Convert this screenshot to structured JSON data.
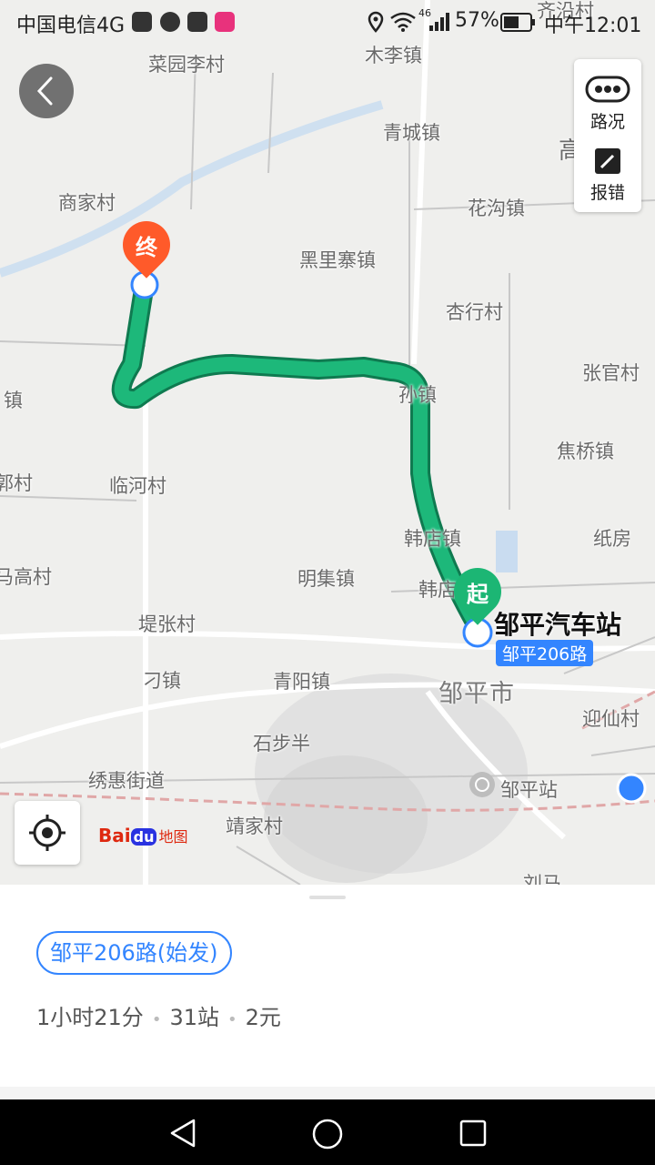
{
  "status_bar": {
    "carrier": "中国电信4G",
    "network_badge": "46",
    "battery": "57%",
    "time": "中午12:01",
    "icons": [
      "baidu-app-icon",
      "qq-icon",
      "tiktok-icon",
      "youku-icon",
      "location-icon",
      "wifi-icon",
      "signal-icon",
      "battery-icon"
    ]
  },
  "map": {
    "places": {
      "caiyuanli": "菜园李村",
      "mulizhen": "木李镇",
      "qichengzhen": "青城镇",
      "huagouzhen": "花沟镇",
      "shangjiacun": "商家村",
      "heilizhaizhen": "黑里寨镇",
      "xinghangcun": "杏行村",
      "zhangguancun": "张官村",
      "sunzhen": "孙镇",
      "zhen_left": "镇",
      "jiaoqiaozhen": "焦桥镇",
      "cun_left": "郭村",
      "linhecun": "临河村",
      "zhifang": "纸房",
      "handianzhen": "韩店镇",
      "magaocun": "马高村",
      "mingjizhen": "明集镇",
      "handian2": "韩店",
      "dizhangcun": "堤张村",
      "diaozhen": "刁镇",
      "qingyangzhen": "青阳镇",
      "zoupingshi": "邹平市",
      "yingxiancun": "迎仙村",
      "shibuban": "石步半",
      "xiuhuijiedao": "绣惠街道",
      "zoupingzhan": "邹平站",
      "jingjiacun": "靖家村",
      "liuma": "刘马",
      "qiyang_top": "齐沿村",
      "gao_right": "高"
    },
    "start_marker": "起",
    "end_marker": "终",
    "start_station": "邹平汽车站",
    "route_badge": "邹平206路",
    "traffic_label": "路况",
    "report_label": "报错",
    "logo": {
      "bai": "Bai",
      "du": "du",
      "ditu": "地图"
    },
    "route_color": "#1db87a",
    "end_color": "#ff5a2a",
    "start_color": "#1cb674"
  },
  "sheet": {
    "route_name": "邹平206路(始发)",
    "duration": "1小时21分",
    "stops": "31站",
    "fare": "2元"
  },
  "navbar": {
    "buttons": [
      "back-nav-icon",
      "home-nav-icon",
      "recents-nav-icon"
    ]
  }
}
